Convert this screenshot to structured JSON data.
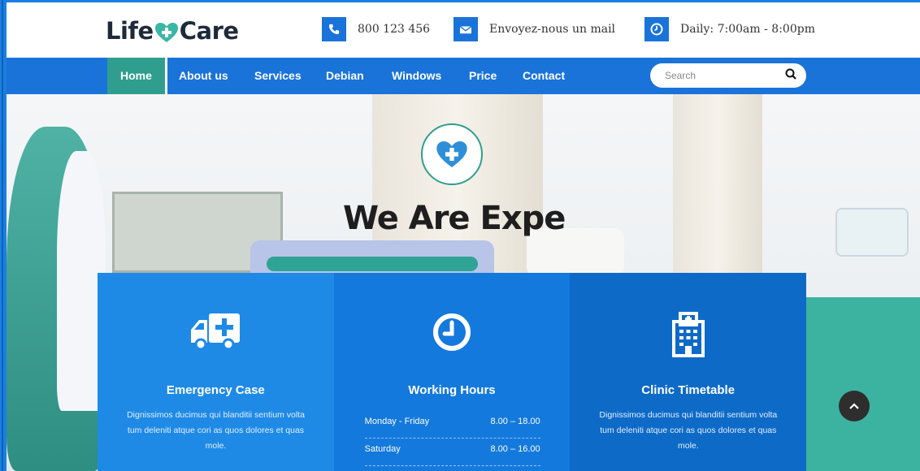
{
  "brand": {
    "logo_left": "Life",
    "logo_right": "Care"
  },
  "contact": [
    {
      "icon": "phone-icon",
      "text": "800 123 456"
    },
    {
      "icon": "envelope-icon",
      "text": "Envoyez-nous un mail"
    },
    {
      "icon": "clock-icon",
      "text": "Daily: 7:00am - 8:00pm"
    }
  ],
  "nav": {
    "items": [
      "Home",
      "About us",
      "Services",
      "Debian",
      "Windows",
      "Price",
      "Contact"
    ],
    "active": "Home",
    "search_placeholder": "Search"
  },
  "hero": {
    "title": "We Are Expe"
  },
  "features": [
    {
      "icon": "ambulance-icon",
      "title": "Emergency Case",
      "text": "Dignissimos ducimus qui blanditii sentium volta tum deleniti atque cori as quos dolores et quas mole."
    },
    {
      "icon": "clock-icon",
      "title": "Working Hours",
      "hours": [
        {
          "day": "Monday - Friday",
          "time": "8.00 – 18.00"
        },
        {
          "day": "Saturday",
          "time": "8.00 – 16.00"
        }
      ]
    },
    {
      "icon": "hospital-icon",
      "title": "Clinic Timetable",
      "text": "Dignissimos ducimus qui blanditii sentium volta tum deleniti atque cori as quos dolores et quas mole."
    }
  ],
  "colors": {
    "primary": "#1a73d9",
    "accent": "#2f9e8f",
    "dark": "#1e2a3a"
  }
}
